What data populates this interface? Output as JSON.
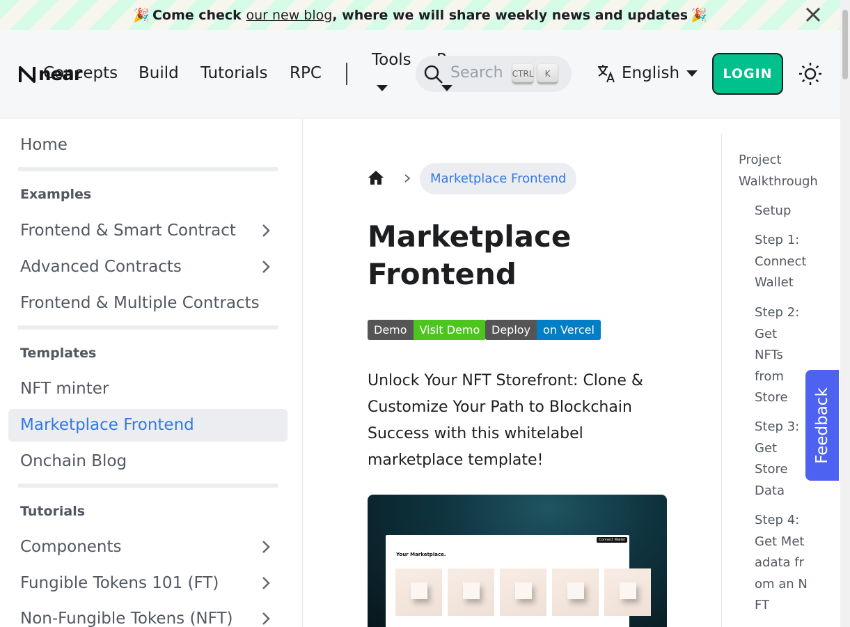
{
  "announcement": {
    "emoji": "🎉",
    "prefix": "Come check",
    "link": "our new blog",
    "suffix": ", where we will share weekly news and updates"
  },
  "navbar": {
    "logo_text": "near",
    "items": [
      "Concepts",
      "Build",
      "Tutorials",
      "RPC",
      "Tools",
      "Resources"
    ],
    "search_placeholder": "Search",
    "search_keys": [
      "CTRL",
      "K"
    ],
    "language": "English",
    "login_label": "LOGIN"
  },
  "sidebar": {
    "home": "Home",
    "examples_title": "Examples",
    "examples": [
      "Frontend & Smart Contract",
      "Advanced Contracts",
      "Frontend & Multiple Contracts"
    ],
    "templates_title": "Templates",
    "templates": [
      "NFT minter",
      "Marketplace Frontend",
      "Onchain Blog"
    ],
    "tutorials_title": "Tutorials",
    "tutorials": [
      "Components",
      "Fungible Tokens 101 (FT)",
      "Non-Fungible Tokens (NFT)"
    ]
  },
  "breadcrumb": {
    "current": "Marketplace Frontend"
  },
  "page": {
    "title": "Marketplace Frontend",
    "badges": [
      {
        "left": "Demo",
        "right": "Visit Demo",
        "right_color": "#4cc61e"
      },
      {
        "left": "Deploy",
        "right": "on Vercel",
        "right_color": "#007ec6"
      }
    ],
    "intro": "Unlock Your NFT Storefront: Clone & Customize Your Path to Blockchain Success with this whitelabel marketplace template!",
    "hero_heading": "Your Marketplace.",
    "hero_button": "Connect Wallet"
  },
  "toc": {
    "top": "Project Walkthrough",
    "items": [
      "Setup",
      "Step 1: Connect Wallet",
      "Step 2: Get NFTs from Store",
      "Step 3: Get Store Data",
      "Step 4: Get Metadata from an NFT"
    ]
  },
  "feedback_label": "Feedback",
  "colors": {
    "accent": "#00c08b",
    "link": "#3578e5",
    "feedback": "#4e62f1"
  }
}
